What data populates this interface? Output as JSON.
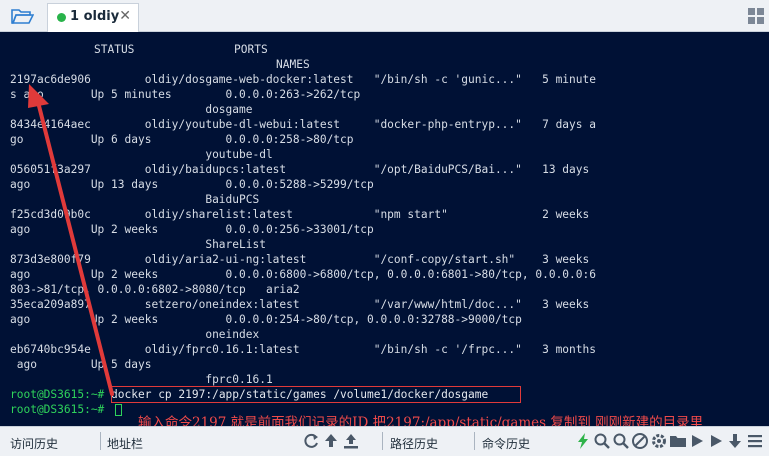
{
  "tab": {
    "label": "1 oldiy",
    "close": "✕"
  },
  "terminal": {
    "header": {
      "status": "STATUS",
      "ports": "PORTS",
      "names": "NAMES"
    },
    "lines": [
      "2197ac6de906        oldiy/dosgame-web-docker:latest   \"/bin/sh -c 'gunic...\"   5 minute",
      "s ago       Up 5 minutes        0.0.0.0:263->262/tcp",
      "                             dosgame",
      "8434e4164aec        oldiy/youtube-dl-webui:latest     \"docker-php-entryp...\"   7 days a",
      "go          Up 6 days           0.0.0.0:258->80/tcp",
      "                             youtube-dl",
      "056051f3a297        oldiy/baidupcs:latest             \"/opt/BaiduPCS/Bai...\"   13 days",
      "ago         Up 13 days          0.0.0.0:5288->5299/tcp",
      "                             BaiduPCS",
      "f25cd3d09b0c        oldiy/sharelist:latest            \"npm start\"              2 weeks",
      "ago         Up 2 weeks          0.0.0.0:256->33001/tcp",
      "                             ShareList",
      "873d3e800f79        oldiy/aria2-ui-ng:latest          \"/conf-copy/start.sh\"    3 weeks",
      "ago         Up 2 weeks          0.0.0.0:6800->6800/tcp, 0.0.0.0:6801->80/tcp, 0.0.0.0:6",
      "803->81/tcp, 0.0.0.0:6802->8080/tcp   aria2",
      "35eca209a897        setzero/oneindex:latest           \"/var/www/html/doc...\"   3 weeks",
      "ago         Up 2 weeks          0.0.0.0:254->80/tcp, 0.0.0.0:32788->9000/tcp",
      "                             oneindex",
      "eb6740bc954e        oldiy/fprc0.16.1:latest           \"/bin/sh -c '/frpc...\"   3 months",
      " ago        Up 5 days",
      "",
      "                             fprc0.16.1"
    ],
    "prompt1": "root@DS3615:~# ",
    "command": "docker cp 2197:/app/static/games /volume1/docker/dosgame",
    "prompt2": "root@DS3615:~# "
  },
  "annotation": "输入命令2197 就是前面我们记录的ID  把2197:/app/static/games 复制到 刚刚新建的目录里",
  "bottombar": {
    "history": "访问历史",
    "address": "地址栏",
    "path_history": "路径历史",
    "command_history": "命令历史"
  },
  "colors": {
    "terminal_bg": "#001135",
    "terminal_text": "#d7dde6",
    "prompt": "#2ed35b",
    "annotation": "#ef4a4a",
    "tab_dot": "#29b34a",
    "chrome_bg": "#eef1f5"
  },
  "icons": [
    "folder-open-icon",
    "grid-icon",
    "refresh-icon",
    "upload-icon",
    "upload-tray-icon",
    "lightning-icon",
    "search-icon",
    "stop-icon",
    "gear-icon",
    "folder-icon",
    "play-icon",
    "download-icon",
    "menu-icon"
  ]
}
